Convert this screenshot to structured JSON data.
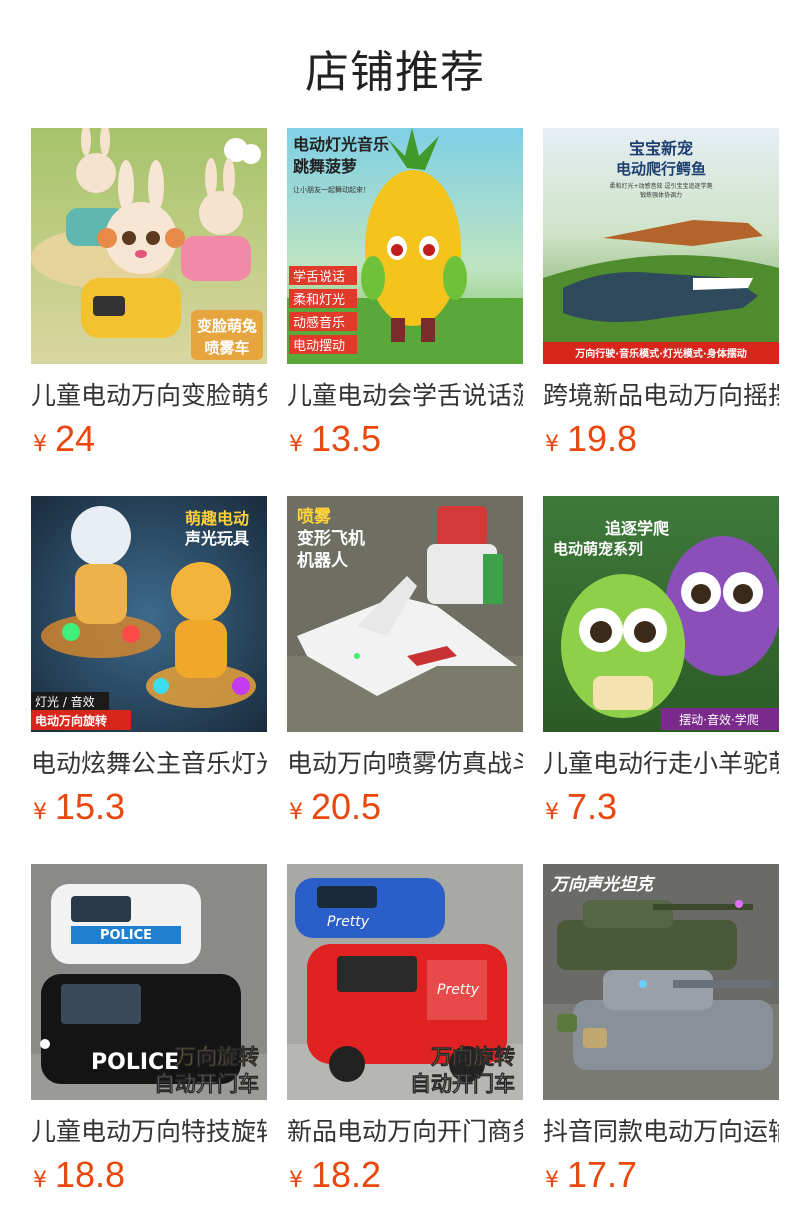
{
  "header": {
    "title": "店铺推荐"
  },
  "currency_symbol": "¥",
  "colors": {
    "price": "#e8470d",
    "title": "#222222",
    "name": "#333333"
  },
  "products": [
    {
      "name": "儿童电动万向变脸萌兔喷雾车",
      "price": "24",
      "image": {
        "icon": "rabbit-car-photo",
        "captions": [
          "变脸萌兔",
          "喷雾车"
        ]
      }
    },
    {
      "name": "儿童电动会学舌说话菠萝",
      "price": "13.5",
      "image": {
        "icon": "pineapple-toy-photo",
        "captions": [
          "电动灯光音乐",
          "跳舞菠萝",
          "让小朋友一起舞动起来！",
          "学舌说话",
          "柔和灯光",
          "动感音乐",
          "电动摆动"
        ]
      }
    },
    {
      "name": "跨境新品电动万向摇摆鳄鱼",
      "price": "19.8",
      "image": {
        "icon": "crocodile-toy-photo",
        "captions": [
          "宝宝新宠",
          "电动爬行鳄鱼",
          "柔和灯光+动感音效 逗引宝宝追逐学爬",
          "锻炼强体协调力",
          "万向行驶·音乐模式·灯光模式·身体摆动"
        ]
      }
    },
    {
      "name": "电动炫舞公主音乐灯光玩具",
      "price": "15.3",
      "image": {
        "icon": "dancing-astronaut-toy-photo",
        "captions": [
          "萌趣电动",
          "声光玩具",
          "灯光 / 音效",
          "电动万向旋转"
        ]
      }
    },
    {
      "name": "电动万向喷雾仿真战斗机变形机器人",
      "price": "20.5",
      "image": {
        "icon": "jet-robot-toy-photo",
        "captions": [
          "喷雾",
          "变形飞机",
          "机器人"
        ]
      }
    },
    {
      "name": "儿童电动行走小羊驼萌宠",
      "price": "7.3",
      "image": {
        "icon": "cute-pet-toy-photo",
        "captions": [
          "追逐学爬",
          "电动萌宠系列",
          "摆动·音效·学爬"
        ]
      }
    },
    {
      "name": "儿童电动万向特技旋转警车",
      "price": "18.8",
      "image": {
        "icon": "police-van-toy-photo",
        "captions": [
          "POLICE",
          "POLICE",
          "万向旋转",
          "自动开门车"
        ]
      }
    },
    {
      "name": "新品电动万向开门商务车",
      "price": "18.2",
      "image": {
        "icon": "red-van-toy-photo",
        "captions": [
          "Pretty",
          "Pretty",
          "万向旋转",
          "自动开门车"
        ]
      }
    },
    {
      "name": "抖音同款电动万向运输坦克",
      "price": "17.7",
      "image": {
        "icon": "tank-toy-photo",
        "captions": [
          "万向声光坦克"
        ]
      }
    }
  ]
}
